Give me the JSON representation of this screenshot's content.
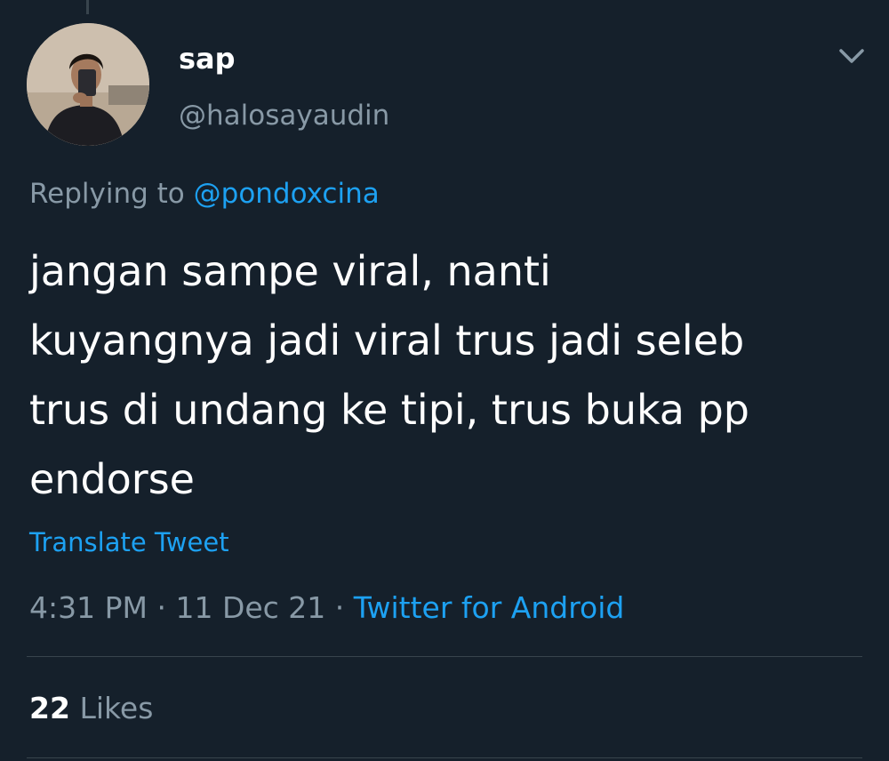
{
  "colors": {
    "background": "#15202b",
    "primary_text": "#ffffff",
    "secondary_text": "#8899a6",
    "accent": "#1da1f2",
    "divider": "#38444d"
  },
  "author": {
    "display_name": "sap",
    "handle": "@halosayaudin",
    "avatar_icon": "profile-photo"
  },
  "menu_icon": "chevron-down-icon",
  "reply": {
    "prefix": "Replying to",
    "mention": "@pondoxcina"
  },
  "tweet": {
    "lines": [
      "jangan sampe viral, nanti",
      "kuyangnya jadi viral trus jadi seleb",
      "trus di undang ke tipi, trus buka pp",
      "endorse"
    ],
    "translate_label": "Translate Tweet"
  },
  "meta": {
    "time": "4:31 PM",
    "separator": "·",
    "date": "11 Dec 21",
    "source": "Twitter for Android"
  },
  "stats": {
    "likes_count": "22",
    "likes_label": "Likes"
  }
}
